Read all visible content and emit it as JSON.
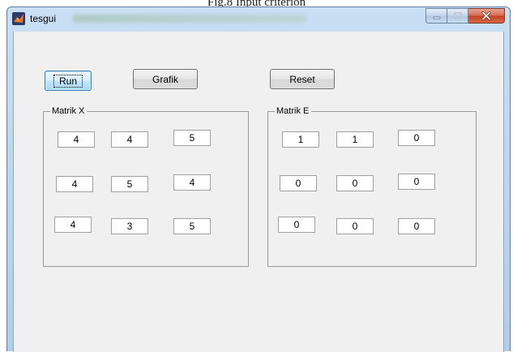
{
  "caption": "Fig.8 Input criterion",
  "window": {
    "title": "tesgui",
    "buttons": {
      "minimize": "minimize",
      "maximize": "maximize",
      "close": "close"
    }
  },
  "toolbar": {
    "run_label": "Run",
    "grafik_label": "Grafik",
    "reset_label": "Reset"
  },
  "matrix_x": {
    "title": "Matrik X",
    "rows": [
      [
        "4",
        "4",
        "5"
      ],
      [
        "4",
        "5",
        "4"
      ],
      [
        "4",
        "3",
        "5"
      ]
    ]
  },
  "matrix_e": {
    "title": "Matrik E",
    "rows": [
      [
        "1",
        "1",
        "0"
      ],
      [
        "0",
        "0",
        "0"
      ],
      [
        "0",
        "0",
        "0"
      ]
    ]
  },
  "colors": {
    "title_bar": "#c9dff3",
    "client_bg": "#f0f0f0",
    "close_red": "#c2401f",
    "focus_blue": "#3c7fb1"
  }
}
